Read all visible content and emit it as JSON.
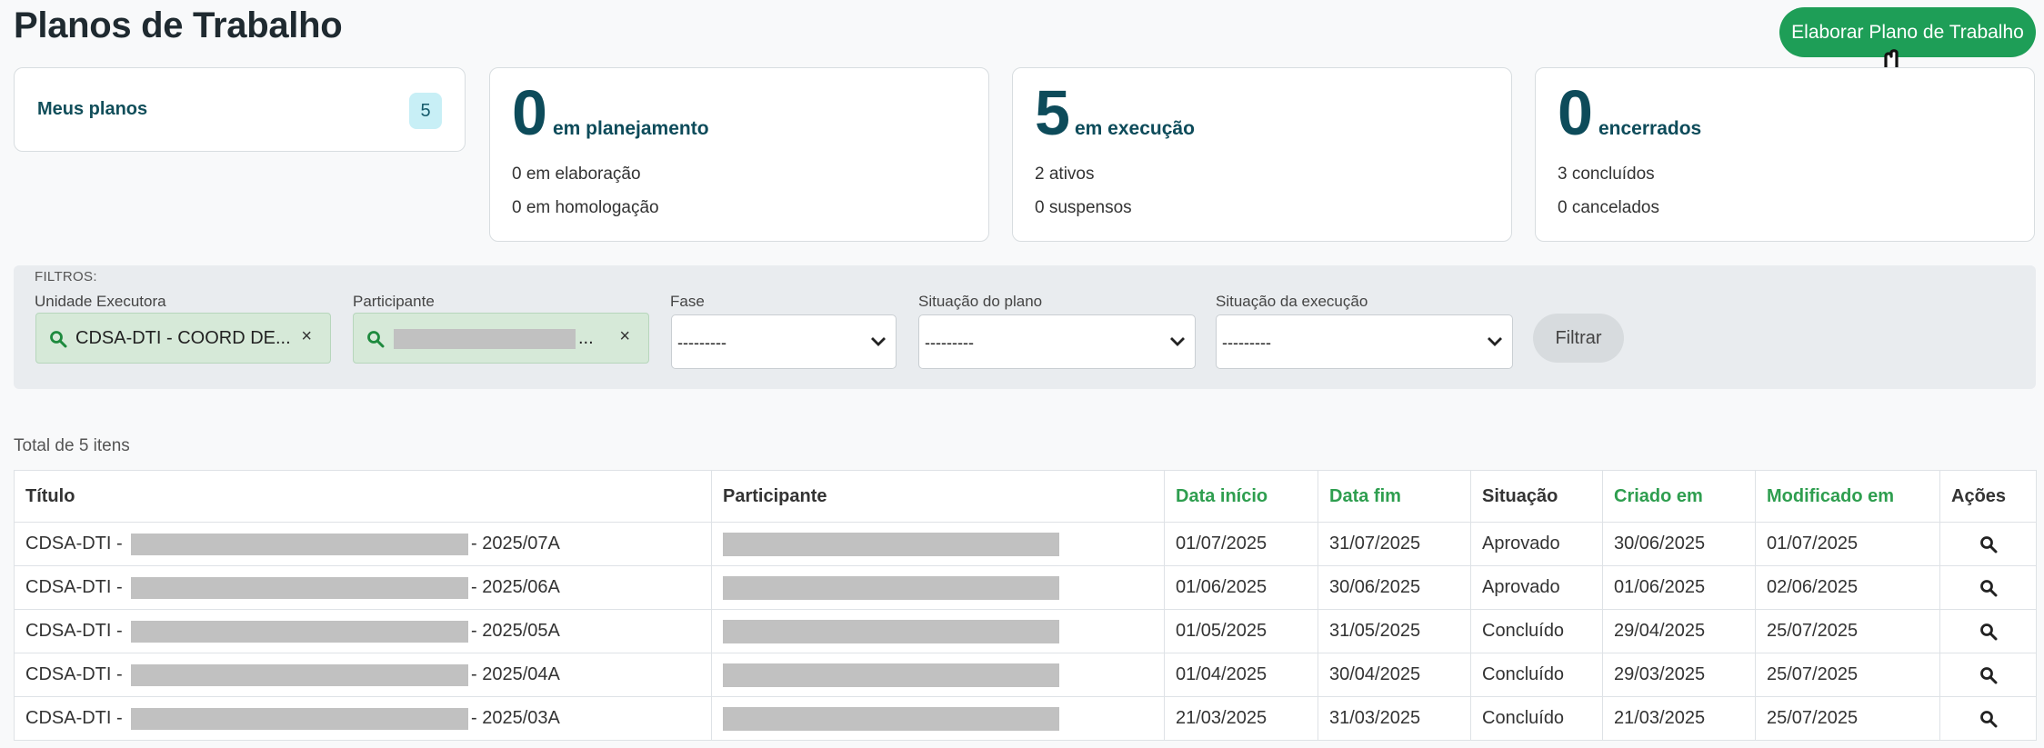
{
  "page": {
    "title": "Planos de Trabalho",
    "primary_action": "Elaborar Plano de Trabalho"
  },
  "summary": {
    "meus_planos": {
      "label": "Meus planos",
      "count": "5"
    },
    "planejamento": {
      "value": "0",
      "label": "em planejamento",
      "line1": "0 em elaboração",
      "line2": "0 em homologação"
    },
    "execucao": {
      "value": "5",
      "label": "em execução",
      "line1": "2 ativos",
      "line2": "0 suspensos"
    },
    "encerrados": {
      "value": "0",
      "label": "encerrados",
      "line1": "3 concluídos",
      "line2": "0 cancelados"
    }
  },
  "filters": {
    "heading": "FILTROS:",
    "unidade": {
      "label": "Unidade Executora",
      "value": "CDSA-DTI - COORD DE...",
      "clear": "×"
    },
    "participante": {
      "label": "Participante",
      "value_suffix": "...",
      "clear": "×"
    },
    "fase": {
      "label": "Fase",
      "value": "---------"
    },
    "situacao_plano": {
      "label": "Situação do plano",
      "value": "---------"
    },
    "situacao_execucao": {
      "label": "Situação da execução",
      "value": "---------"
    },
    "submit": "Filtrar"
  },
  "table": {
    "total": "Total de 5 itens",
    "headers": {
      "titulo": "Título",
      "participante": "Participante",
      "data_inicio": "Data início",
      "data_fim": "Data fim",
      "situacao": "Situação",
      "criado_em": "Criado em",
      "modificado_em": "Modificado em",
      "acoes": "Ações"
    },
    "rows": [
      {
        "prefix": "CDSA-DTI -",
        "suffix": "- 2025/07A",
        "data_inicio": "01/07/2025",
        "data_fim": "31/07/2025",
        "situacao": "Aprovado",
        "criado_em": "30/06/2025",
        "modificado_em": "01/07/2025"
      },
      {
        "prefix": "CDSA-DTI -",
        "suffix": "- 2025/06A",
        "data_inicio": "01/06/2025",
        "data_fim": "30/06/2025",
        "situacao": "Aprovado",
        "criado_em": "01/06/2025",
        "modificado_em": "02/06/2025"
      },
      {
        "prefix": "CDSA-DTI -",
        "suffix": "- 2025/05A",
        "data_inicio": "01/05/2025",
        "data_fim": "31/05/2025",
        "situacao": "Concluído",
        "criado_em": "29/04/2025",
        "modificado_em": "25/07/2025"
      },
      {
        "prefix": "CDSA-DTI -",
        "suffix": "- 2025/04A",
        "data_inicio": "01/04/2025",
        "data_fim": "30/04/2025",
        "situacao": "Concluído",
        "criado_em": "29/03/2025",
        "modificado_em": "25/07/2025"
      },
      {
        "prefix": "CDSA-DTI -",
        "suffix": "- 2025/03A",
        "data_inicio": "21/03/2025",
        "data_fim": "31/03/2025",
        "situacao": "Concluído",
        "criado_em": "21/03/2025",
        "modificado_em": "25/07/2025"
      }
    ]
  },
  "colors": {
    "primary_green": "#1e9e57",
    "sortable_header": "#2e9e4f",
    "heading_teal": "#0d4b5a",
    "badge_bg": "#c8eff6"
  },
  "icons": [
    "search-icon",
    "close-icon",
    "chevron-down-icon",
    "hand-cursor-icon"
  ]
}
